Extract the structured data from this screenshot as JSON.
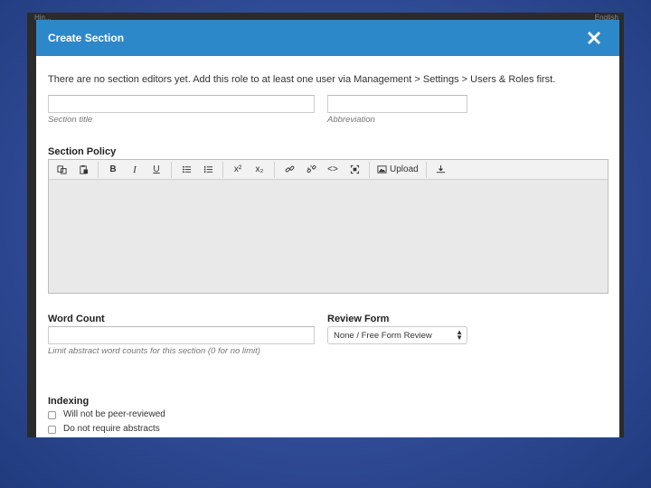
{
  "background": {
    "left_text": "Hin...",
    "right_text": "English"
  },
  "dialog": {
    "title": "Create Section",
    "close_icon": "close-icon",
    "notice": "There are no section editors yet. Add this role to at least one user via Management > Settings > Users & Roles first.",
    "fields": {
      "section_title_hint": "Section title",
      "abbreviation_hint": "Abbreviation",
      "section_policy_label": "Section Policy",
      "word_count_label": "Word Count",
      "word_count_hint": "Limit abstract word counts for this section (0 for no limit)",
      "review_form_label": "Review Form",
      "review_form_selected": "None / Free Form Review"
    },
    "toolbar": {
      "icons": [
        "copy-icon",
        "paste-icon",
        "bold-icon",
        "italic-icon",
        "underline-icon",
        "bullet-list-icon",
        "numbered-list-icon",
        "superscript-icon",
        "subscript-icon",
        "link-icon",
        "unlink-icon",
        "code-icon",
        "fullscreen-icon",
        "image-icon",
        "download-icon"
      ],
      "bold": "B",
      "italic": "I",
      "underline": "U",
      "superscript": "x²",
      "subscript": "x₂",
      "code": "<>",
      "upload_label": "Upload"
    },
    "indexing": {
      "label": "Indexing",
      "options": [
        "Will not be peer-reviewed",
        "Do not require abstracts"
      ]
    }
  },
  "colors": {
    "header": "#2d88c9",
    "background": "#34509c"
  }
}
